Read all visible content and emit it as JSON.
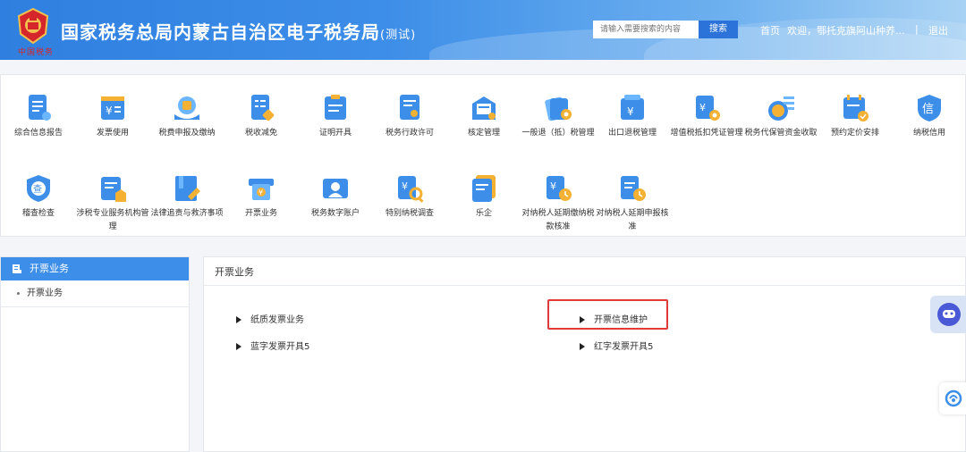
{
  "header": {
    "title": "国家税务总局内蒙古自治区电子税务局",
    "title_suffix": "(测试)",
    "seal_text": "中国税务",
    "search_placeholder": "请输入需要搜索的内容",
    "search_button": "搜索",
    "home_link": "首页",
    "welcome_text": "欢迎，鄂托克旗阿山种养...",
    "separator": "|",
    "logout_link": "退出"
  },
  "tiles_row1": [
    {
      "label": "综合信息报告",
      "icon": "report-icon"
    },
    {
      "label": "发票使用",
      "icon": "invoice-icon"
    },
    {
      "label": "税费申报及缴纳",
      "icon": "tax-payment-icon"
    },
    {
      "label": "税收减免",
      "icon": "tax-reduction-icon"
    },
    {
      "label": "证明开具",
      "icon": "certificate-icon"
    },
    {
      "label": "税务行政许可",
      "icon": "license-icon"
    },
    {
      "label": "核定管理",
      "icon": "verify-icon"
    },
    {
      "label": "一般退（抵）税管理",
      "icon": "refund-icon"
    },
    {
      "label": "出口退税管理",
      "icon": "export-refund-icon"
    },
    {
      "label": "增值税抵扣凭证管理",
      "icon": "vat-deduction-icon"
    },
    {
      "label": "税务代保管资金收取",
      "icon": "custody-fund-icon"
    },
    {
      "label": "预约定价安排",
      "icon": "pricing-calendar-icon"
    },
    {
      "label": "纳税信用",
      "icon": "credit-icon"
    }
  ],
  "tiles_row2": [
    {
      "label": "稽查检查",
      "icon": "inspection-icon"
    },
    {
      "label": "涉税专业服务机构管理",
      "icon": "service-agency-icon"
    },
    {
      "label": "法律追责与救济事项",
      "icon": "legal-icon"
    },
    {
      "label": "开票业务",
      "icon": "invoicing-icon"
    },
    {
      "label": "税务数字账户",
      "icon": "digital-account-icon"
    },
    {
      "label": "特别纳税调查",
      "icon": "special-investigation-icon"
    },
    {
      "label": "乐企",
      "icon": "enterprise-icon"
    },
    {
      "label": "对纳税人延期缴纳税款核准",
      "icon": "deferred-payment-icon"
    },
    {
      "label": "对纳税人延期申报核准",
      "icon": "deferred-filing-icon"
    }
  ],
  "sidebar": {
    "header": "开票业务",
    "items": [
      "开票业务"
    ]
  },
  "main": {
    "title": "开票业务",
    "links": [
      "纸质发票业务",
      "开票信息维护",
      "蓝字发票开具5",
      "红字发票开具5"
    ]
  },
  "colors": {
    "brand_blue": "#3d8ee8",
    "highlight_red": "#e03a3a"
  }
}
